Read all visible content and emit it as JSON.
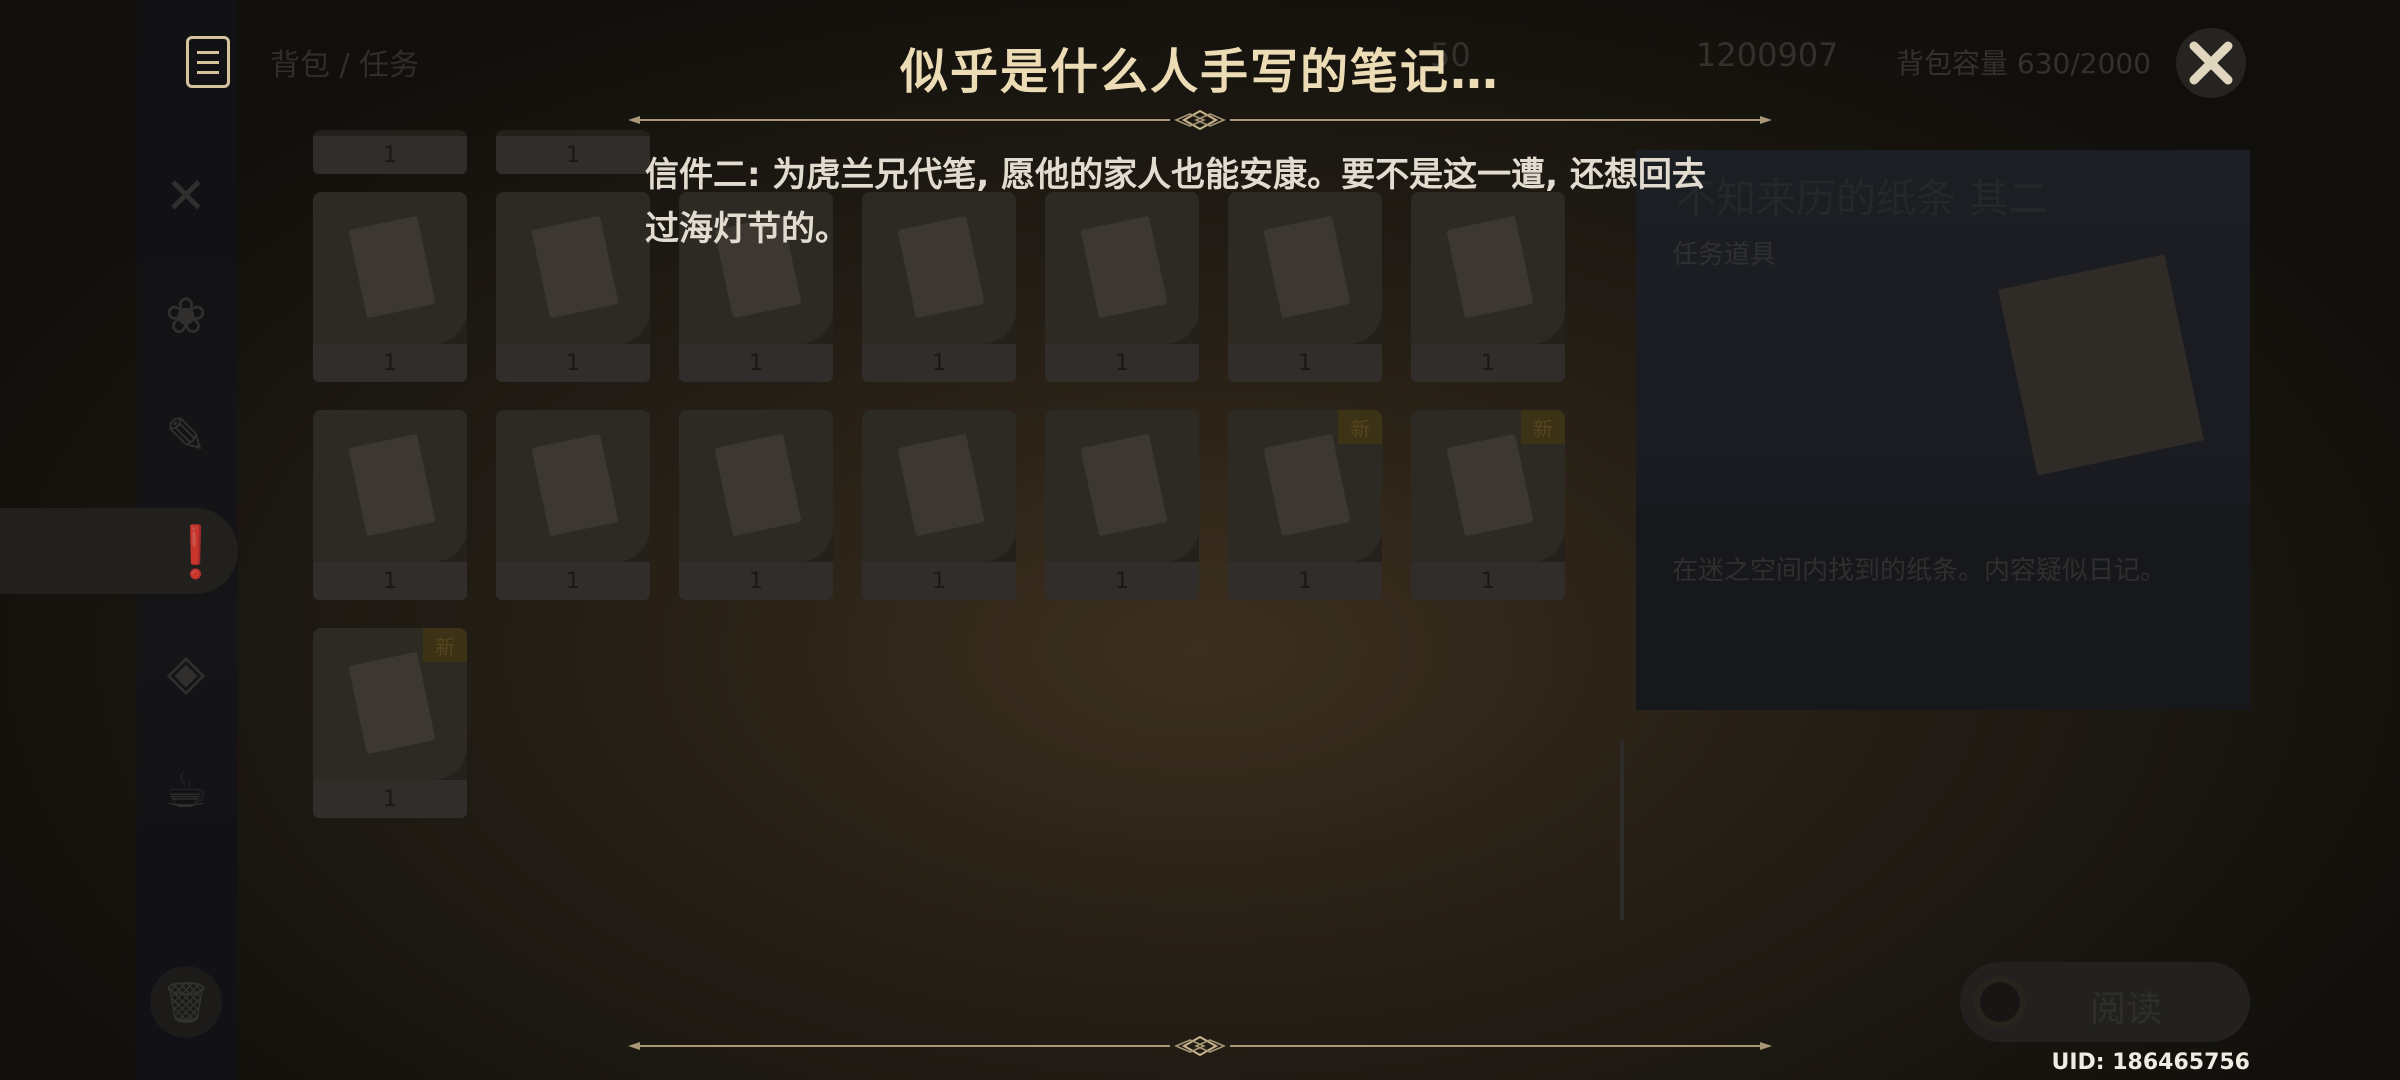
{
  "note": {
    "title": "似乎是什么人手写的笔记…",
    "line1": "信件二: 为虎兰兄代笔, 愿他的家人也能安康。要不是这一遭, 还想回去",
    "line2": "过海灯节的。"
  },
  "background": {
    "breadcrumb": "背包 / 任务",
    "resin": "50",
    "mora": "1200907",
    "capacity": "背包容量 630/2000",
    "detail_title": "不知来历的纸条 其二",
    "detail_category": "任务道具",
    "detail_desc": "在迷之空间内找到的纸条。内容疑似日记。",
    "read_label": "阅读",
    "qty": "1",
    "new_badge": "新"
  },
  "uid": "UID: 186465756",
  "icons": {
    "note": "note-icon",
    "close": "close-icon",
    "trash": "trash-icon"
  },
  "colors": {
    "title": "#ecdcb6",
    "body_text": "#e2dcd0",
    "ornament": "#a89878"
  }
}
